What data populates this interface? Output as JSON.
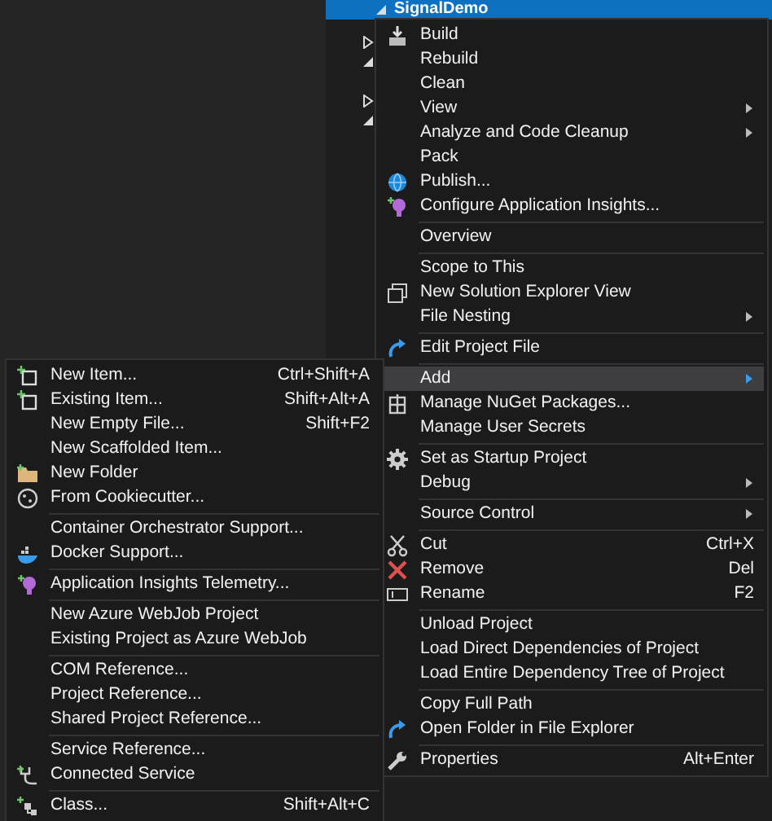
{
  "tree": {
    "rows": [
      {
        "label": "SignalDemo",
        "selected": true,
        "expanded": true
      },
      {
        "expanded": false
      },
      {
        "expanded": true
      },
      {
        "expanded": false
      },
      {
        "expanded": true
      }
    ]
  },
  "context_menu": {
    "items": [
      {
        "kind": "item",
        "label": "Build",
        "selected": false
      },
      {
        "kind": "item",
        "label": "Rebuild",
        "selected": false
      },
      {
        "kind": "item",
        "label": "Clean",
        "selected": false
      },
      {
        "kind": "item",
        "label": "View",
        "submenu": true,
        "selected": false
      },
      {
        "kind": "item",
        "label": "Analyze and Code Cleanup",
        "submenu": true,
        "selected": false
      },
      {
        "kind": "item",
        "label": "Pack",
        "selected": false
      },
      {
        "kind": "item",
        "label": "Publish...",
        "selected": false
      },
      {
        "kind": "item",
        "label": "Configure Application Insights...",
        "selected": false
      },
      {
        "kind": "separator"
      },
      {
        "kind": "item",
        "label": "Overview",
        "selected": false
      },
      {
        "kind": "separator"
      },
      {
        "kind": "item",
        "label": "Scope to This",
        "selected": false
      },
      {
        "kind": "item",
        "label": "New Solution Explorer View",
        "selected": false
      },
      {
        "kind": "item",
        "label": "File Nesting",
        "submenu": true,
        "selected": false
      },
      {
        "kind": "separator"
      },
      {
        "kind": "item",
        "label": "Edit Project File",
        "selected": false
      },
      {
        "kind": "separator"
      },
      {
        "kind": "item",
        "label": "Add",
        "submenu": true,
        "selected": true
      },
      {
        "kind": "item",
        "label": "Manage NuGet Packages...",
        "selected": false
      },
      {
        "kind": "item",
        "label": "Manage User Secrets",
        "selected": false
      },
      {
        "kind": "separator"
      },
      {
        "kind": "item",
        "label": "Set as Startup Project",
        "selected": false
      },
      {
        "kind": "item",
        "label": "Debug",
        "submenu": true,
        "selected": false
      },
      {
        "kind": "separator"
      },
      {
        "kind": "item",
        "label": "Source Control",
        "submenu": true,
        "selected": false
      },
      {
        "kind": "separator"
      },
      {
        "kind": "item",
        "label": "Cut",
        "shortcut": "Ctrl+X",
        "selected": false
      },
      {
        "kind": "item",
        "label": "Remove",
        "shortcut": "Del",
        "selected": false
      },
      {
        "kind": "item",
        "label": "Rename",
        "shortcut": "F2",
        "selected": false
      },
      {
        "kind": "separator"
      },
      {
        "kind": "item",
        "label": "Unload Project",
        "selected": false
      },
      {
        "kind": "item",
        "label": "Load Direct Dependencies of Project",
        "selected": false
      },
      {
        "kind": "item",
        "label": "Load Entire Dependency Tree of Project",
        "selected": false
      },
      {
        "kind": "separator"
      },
      {
        "kind": "item",
        "label": "Copy Full Path",
        "selected": false
      },
      {
        "kind": "item",
        "label": "Open Folder in File Explorer",
        "selected": false
      },
      {
        "kind": "separator"
      },
      {
        "kind": "item",
        "label": "Properties",
        "shortcut": "Alt+Enter",
        "selected": false
      }
    ]
  },
  "add_submenu": {
    "items": [
      {
        "kind": "item",
        "label": "New Item...",
        "shortcut": "Ctrl+Shift+A"
      },
      {
        "kind": "item",
        "label": "Existing Item...",
        "shortcut": "Shift+Alt+A"
      },
      {
        "kind": "item",
        "label": "New Empty File...",
        "shortcut": "Shift+F2"
      },
      {
        "kind": "item",
        "label": "New Scaffolded Item..."
      },
      {
        "kind": "item",
        "label": "New Folder"
      },
      {
        "kind": "item",
        "label": "From Cookiecutter..."
      },
      {
        "kind": "separator"
      },
      {
        "kind": "item",
        "label": "Container Orchestrator Support..."
      },
      {
        "kind": "item",
        "label": "Docker Support..."
      },
      {
        "kind": "separator"
      },
      {
        "kind": "item",
        "label": "Application Insights Telemetry..."
      },
      {
        "kind": "separator"
      },
      {
        "kind": "item",
        "label": "New Azure WebJob Project"
      },
      {
        "kind": "item",
        "label": "Existing Project as Azure WebJob"
      },
      {
        "kind": "separator"
      },
      {
        "kind": "item",
        "label": "COM Reference..."
      },
      {
        "kind": "item",
        "label": "Project Reference..."
      },
      {
        "kind": "item",
        "label": "Shared Project Reference..."
      },
      {
        "kind": "separator"
      },
      {
        "kind": "item",
        "label": "Service Reference..."
      },
      {
        "kind": "item",
        "label": "Connected Service"
      },
      {
        "kind": "separator"
      },
      {
        "kind": "item",
        "label": "Class...",
        "shortcut": "Shift+Alt+C"
      }
    ]
  }
}
